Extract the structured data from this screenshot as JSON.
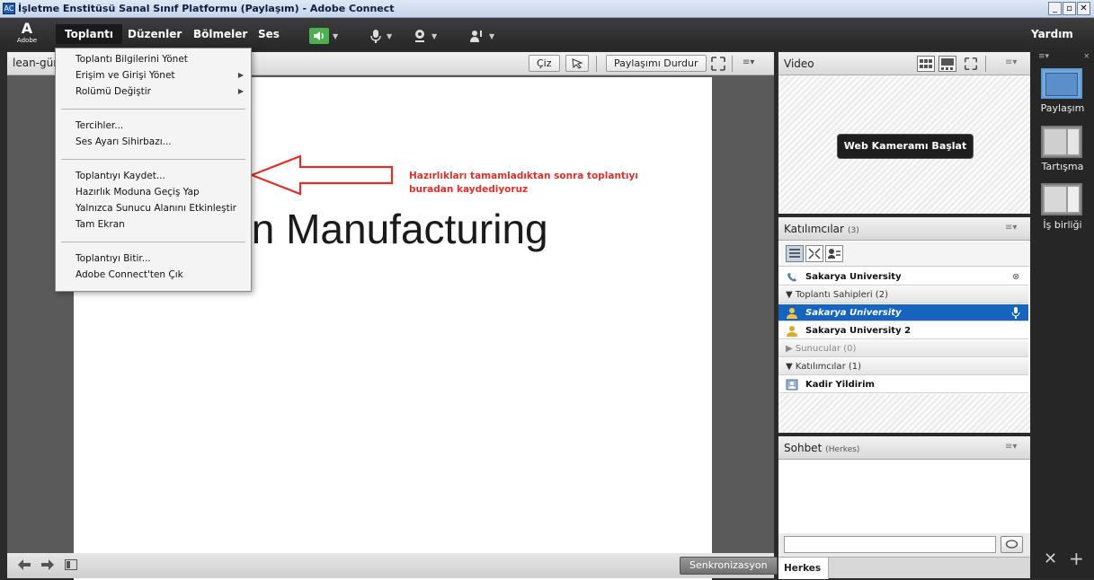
{
  "window": {
    "title": "İşletme Enstitüsü Sanal Sınıf Platformu (Paylaşım) - Adobe Connect",
    "icon_text": "AC",
    "controls": [
      "_",
      "▫",
      "✕"
    ]
  },
  "logo": {
    "glyph": "A",
    "text": "Adobe"
  },
  "menubar": {
    "items": [
      "Toplantı",
      "Düzenler",
      "Bölmeler",
      "Ses"
    ],
    "help": "Yardım"
  },
  "dropdown": {
    "items": [
      "Toplantı Bilgilerini Yönet",
      "Erişim ve Girişi Yönet",
      "Rolümü Değiştir",
      "Tercihler...",
      "Ses Ayarı Sihirbazı...",
      "Toplantıyı Kaydet...",
      "Hazırlık Moduna Geçiş Yap",
      "Yalnızca Sunucu Alanını Etkinleştir",
      "Tam Ekran",
      "Toplantıyı Bitir...",
      "Adobe Connect'ten Çık"
    ]
  },
  "share": {
    "title": "lean-gün",
    "draw_btn": "Çiz",
    "stop_btn": "Paylaşımı Durdur",
    "slide_title": "Lean Manufacturing",
    "sync_btn": "Senkronizasyon"
  },
  "annotation": {
    "line1": "Hazırlıkları tamamladıktan sonra toplantıyı",
    "line2": "buradan kaydediyoruz"
  },
  "video": {
    "title": "Video",
    "webcam_btn": "Web Kameramı Başlat"
  },
  "attendees": {
    "title": "Katılımcılar",
    "count": "(3)",
    "rows": {
      "phone_user": "Sakarya University",
      "hosts_group": "Toplantı Sahipleri (2)",
      "host1": "Sakarya University",
      "host2": "Sakarya University 2",
      "presenters_group": "Sunucular (0)",
      "participants_group": "Katılımcılar (1)",
      "participant1": "Kadir Yildirim"
    }
  },
  "chat": {
    "title": "Sohbet",
    "scope": "(Herkes)",
    "tab": "Herkes"
  },
  "layouts": [
    "Paylaşım",
    "Tartışma",
    "İş birliği"
  ],
  "colors": {
    "accent": "#1565c0",
    "annotation": "#e0302a",
    "bar": "#262626"
  }
}
